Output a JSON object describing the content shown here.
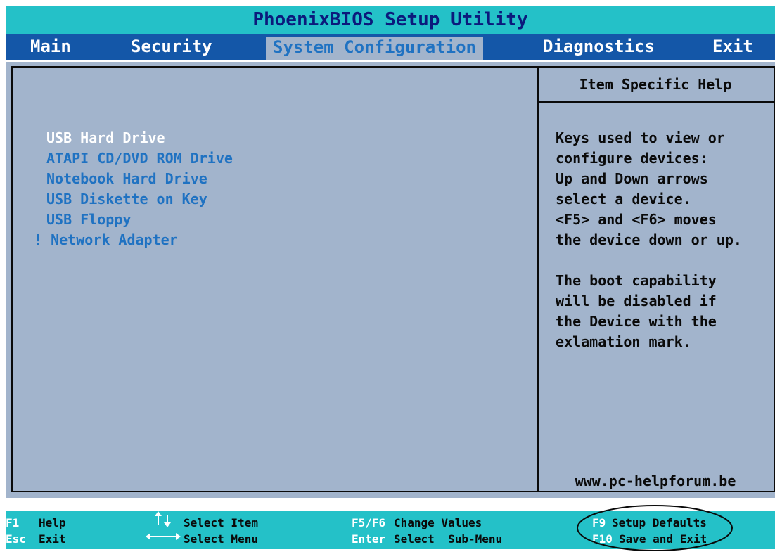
{
  "title": "PhoenixBIOS Setup Utility",
  "menu": {
    "main": "Main",
    "security": "Security",
    "system_configuration": "System Configuration",
    "diagnostics": "Diagnostics",
    "exit": "Exit",
    "active": "System Configuration"
  },
  "boot_order": {
    "items": [
      {
        "label": "USB Hard Drive",
        "selected": true
      },
      {
        "label": "ATAPI CD/DVD ROM Drive"
      },
      {
        "label": "Notebook Hard Drive"
      },
      {
        "label": "USB Diskette on Key"
      },
      {
        "label": "USB Floppy"
      },
      {
        "label": "! Network Adapter",
        "marker": "!"
      }
    ]
  },
  "help": {
    "header": "Item Specific Help",
    "text": "Keys used to view or\nconfigure devices:\nUp and Down arrows\nselect a device.\n<F5> and <F6> moves\nthe device down or up.\n\nThe boot capability\nwill be disabled if\nthe Device with the\nexlamation mark.",
    "url": "www.pc-helpforum.be"
  },
  "footer": {
    "f1_key": "F1",
    "f1_desc": "Help",
    "esc_key": "Esc",
    "esc_desc": "Exit",
    "select_item": "Select Item",
    "select_menu": "Select Menu",
    "f5f6_key": "F5/F6",
    "f5f6_desc": "Change Values",
    "enter_key": "Enter",
    "enter_desc": "Select  Sub-Menu",
    "f9_key": "F9",
    "f9_desc": "Setup Defaults",
    "f10_key": "F10",
    "f10_desc": "Save and Exit"
  },
  "colors": {
    "title_bar": "#24c1c8",
    "menu_bar": "#1457a8",
    "panel_bg": "#a2b4cc",
    "item_blue": "#1f72c2",
    "title_text": "#0b1a7c"
  }
}
